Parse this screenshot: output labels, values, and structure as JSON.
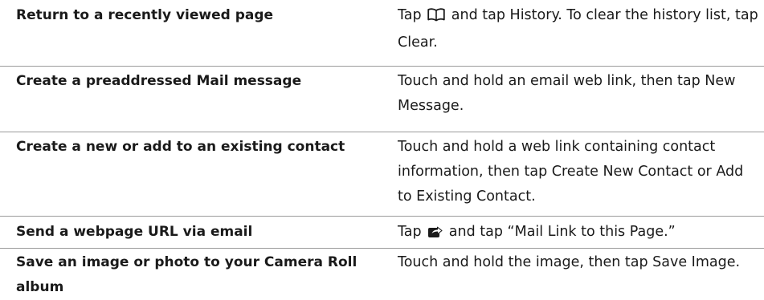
{
  "rows": [
    {
      "task": "Return to a recently viewed page",
      "how_before": "Tap",
      "icon": "bookmarks-book-icon",
      "how_after": "and tap History. To clear the history list, tap Clear."
    },
    {
      "task": "Create a preaddressed Mail message",
      "how": "Touch and hold an email web link, then tap New Message."
    },
    {
      "task": "Create a new or add to an existing contact",
      "how": "Touch and hold a web link containing contact information, then tap Create New Contact or Add to Existing Contact."
    },
    {
      "task": "Send a webpage URL via email",
      "how_before": "Tap",
      "icon": "action-share-icon",
      "how_after": "and tap “Mail Link to this Page.”"
    },
    {
      "task": "Save an image or photo to your Camera Roll album",
      "how": "Touch and hold the image, then tap Save Image."
    }
  ]
}
